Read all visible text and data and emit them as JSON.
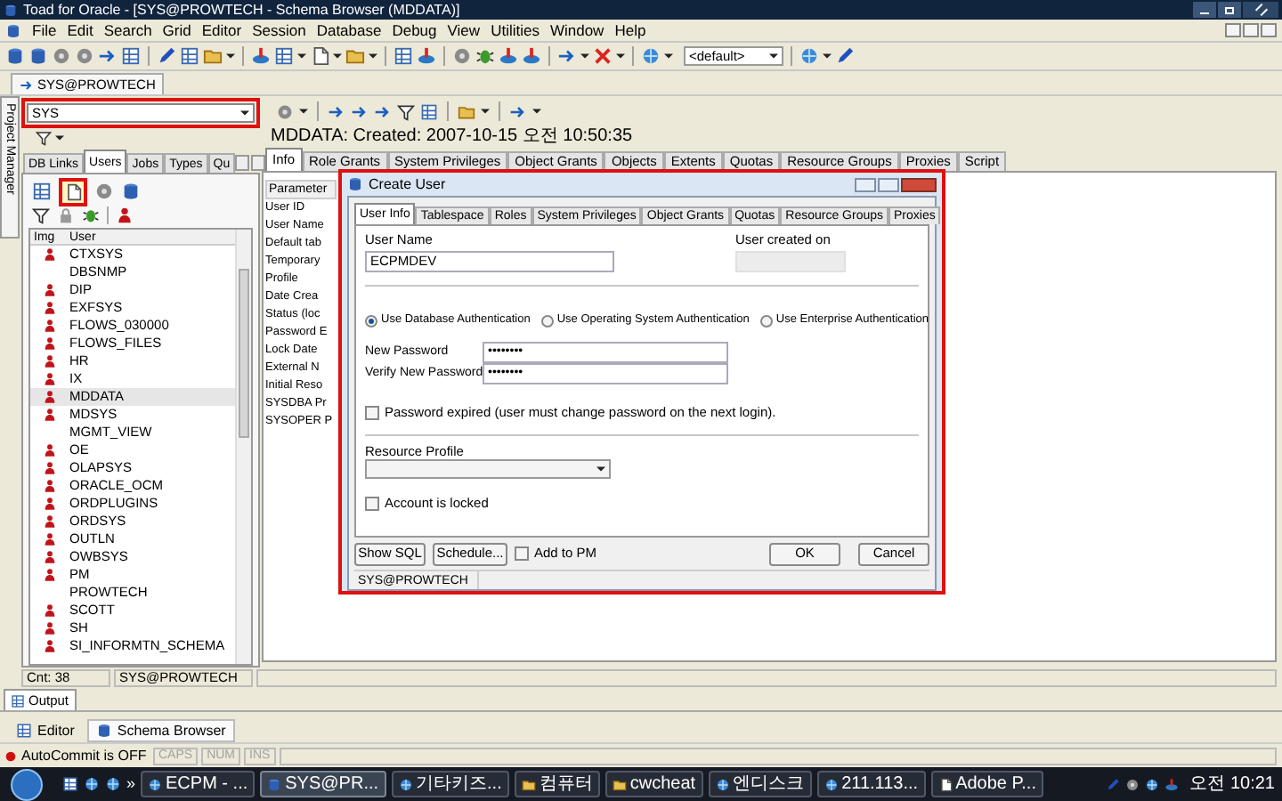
{
  "window": {
    "title": "Toad for Oracle - [SYS@PROWTECH - Schema Browser (MDDATA)]"
  },
  "menu": [
    "File",
    "Edit",
    "Search",
    "Grid",
    "Editor",
    "Session",
    "Database",
    "Debug",
    "View",
    "Utilities",
    "Window",
    "Help"
  ],
  "toolbar": {
    "combo": "<default>"
  },
  "connection_tab": "SYS@PROWTECH",
  "side_tab": "Project Manager",
  "schema_combo": {
    "value": "SYS"
  },
  "left_tabs": [
    {
      "label": "DB Links",
      "selected": false
    },
    {
      "label": "Users",
      "selected": true
    },
    {
      "label": "Jobs",
      "selected": false
    },
    {
      "label": "Types",
      "selected": false
    },
    {
      "label": "Qu",
      "selected": false
    }
  ],
  "user_list": {
    "columns": [
      "Img",
      "User"
    ],
    "rows": [
      {
        "name": "CTXSYS",
        "kind": "icon",
        "selected": false
      },
      {
        "name": "DBSNMP",
        "kind": "plain",
        "selected": false
      },
      {
        "name": "DIP",
        "kind": "icon",
        "selected": false
      },
      {
        "name": "EXFSYS",
        "kind": "icon",
        "selected": false
      },
      {
        "name": "FLOWS_030000",
        "kind": "icon",
        "selected": false
      },
      {
        "name": "FLOWS_FILES",
        "kind": "icon",
        "selected": false
      },
      {
        "name": "HR",
        "kind": "icon",
        "selected": false
      },
      {
        "name": "IX",
        "kind": "icon",
        "selected": false
      },
      {
        "name": "MDDATA",
        "kind": "icon",
        "selected": true
      },
      {
        "name": "MDSYS",
        "kind": "icon",
        "selected": false
      },
      {
        "name": "MGMT_VIEW",
        "kind": "plain",
        "selected": false
      },
      {
        "name": "OE",
        "kind": "icon",
        "selected": false
      },
      {
        "name": "OLAPSYS",
        "kind": "icon",
        "selected": false
      },
      {
        "name": "ORACLE_OCM",
        "kind": "icon",
        "selected": false
      },
      {
        "name": "ORDPLUGINS",
        "kind": "icon",
        "selected": false
      },
      {
        "name": "ORDSYS",
        "kind": "icon",
        "selected": false
      },
      {
        "name": "OUTLN",
        "kind": "icon",
        "selected": false
      },
      {
        "name": "OWBSYS",
        "kind": "icon",
        "selected": false
      },
      {
        "name": "PM",
        "kind": "icon",
        "selected": false
      },
      {
        "name": "PROWTECH",
        "kind": "plain",
        "selected": false
      },
      {
        "name": "SCOTT",
        "kind": "icon",
        "selected": false
      },
      {
        "name": "SH",
        "kind": "icon",
        "selected": false
      },
      {
        "name": "SI_INFORMTN_SCHEMA",
        "kind": "icon",
        "selected": false
      }
    ]
  },
  "object_info": "MDDATA:  Created: 2007-10-15 오전 10:50:35",
  "detail_tabs": [
    {
      "label": "Info",
      "selected": true
    },
    {
      "label": "Role Grants",
      "selected": false
    },
    {
      "label": "System Privileges",
      "selected": false
    },
    {
      "label": "Object Grants",
      "selected": false
    },
    {
      "label": "Objects",
      "selected": false
    },
    {
      "label": "Extents",
      "selected": false
    },
    {
      "label": "Quotas",
      "selected": false
    },
    {
      "label": "Resource Groups",
      "selected": false
    },
    {
      "label": "Proxies",
      "selected": false
    },
    {
      "label": "Script",
      "selected": false
    }
  ],
  "parameters": {
    "header": "Parameter",
    "rows": [
      "User ID",
      "User Name",
      "Default tab",
      "Temporary",
      "Profile",
      "Date Crea",
      "Status (loc",
      "Password E",
      "Lock Date",
      "External N",
      "Initial Reso",
      "SYSDBA Pr",
      "SYSOPER P"
    ]
  },
  "dialog": {
    "title": "Create User",
    "tabs": [
      {
        "label": "User Info",
        "selected": true
      },
      {
        "label": "Tablespace",
        "selected": false
      },
      {
        "label": "Roles",
        "selected": false
      },
      {
        "label": "System Privileges",
        "selected": false
      },
      {
        "label": "Object Grants",
        "selected": false
      },
      {
        "label": "Quotas",
        "selected": false
      },
      {
        "label": "Resource Groups",
        "selected": false
      },
      {
        "label": "Proxies",
        "selected": false
      }
    ],
    "user_name": {
      "label": "User Name",
      "value": "ECPMDEV"
    },
    "user_created_on": {
      "label": "User created on",
      "disabled": true
    },
    "auth_options": [
      {
        "label": "Use Database Authentication",
        "selected": true
      },
      {
        "label": "Use Operating System Authentication",
        "selected": false
      },
      {
        "label": "Use Enterprise Authentication",
        "selected": false
      }
    ],
    "new_password": {
      "label": "New Password",
      "value": "••••••••"
    },
    "verify_password": {
      "label": "Verify New Password",
      "value": "••••••••"
    },
    "password_expired": {
      "label": "Password expired (user must change password on the next login).",
      "checked": false
    },
    "resource_profile": {
      "label": "Resource Profile"
    },
    "account_locked": {
      "label": "Account is locked",
      "checked": false
    },
    "buttons": [
      "Show SQL",
      "Schedule...",
      "OK",
      "Cancel"
    ],
    "add_to_pm": {
      "label": "Add to PM",
      "checked": false
    },
    "status": "SYS@PROWTECH"
  },
  "status_row": [
    "Cnt: 38",
    "SYS@PROWTECH"
  ],
  "output_tab": "Output",
  "doc_tabs": [
    {
      "label": "Editor",
      "selected": false
    },
    {
      "label": "Schema Browser",
      "selected": true
    }
  ],
  "status_bar": {
    "autocommit": "AutoCommit is OFF",
    "indicators": [
      "CAPS",
      "NUM",
      "INS"
    ]
  },
  "taskbar": {
    "overflow": "»",
    "tasks": [
      {
        "label": "ECPM - ...",
        "selected": false
      },
      {
        "label": "SYS@PR...",
        "selected": true
      },
      {
        "label": "기타키즈...",
        "selected": false
      },
      {
        "label": "컴퓨터",
        "selected": false
      },
      {
        "label": "cwcheat",
        "selected": false
      },
      {
        "label": "엔디스크",
        "selected": false
      },
      {
        "label": "211.113...",
        "selected": false
      },
      {
        "label": "Adobe P...",
        "selected": false
      }
    ],
    "clock": "오전 10:21"
  }
}
